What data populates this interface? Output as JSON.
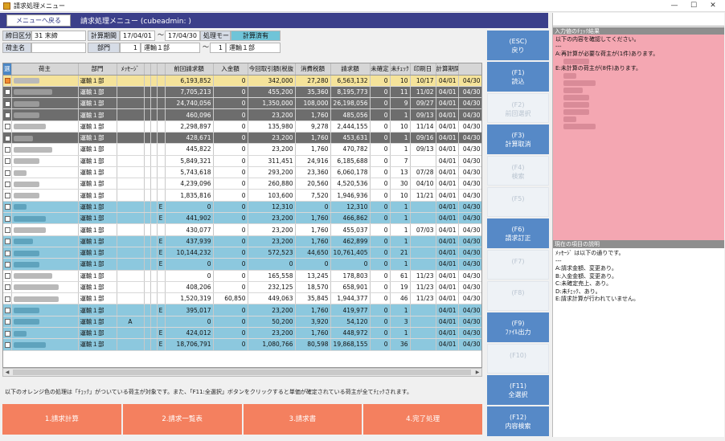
{
  "window": {
    "title": "請求処理メニュー",
    "min": "—",
    "max": "☐",
    "close": "✕"
  },
  "header": {
    "back_label": "メニューへ戻る",
    "title": "請求処理メニュー (cubeadmin:              )"
  },
  "filters": {
    "date_div_label": "締日区分",
    "date_div_code": "31",
    "date_div_value": "末締",
    "period_label": "計算期間",
    "period_from": "17/04/01",
    "period_sep": "～",
    "period_to": "17/04/30",
    "mode_label": "処理モード",
    "mode_value": "計算済有",
    "shipper_label": "荷主名",
    "dept_label": "部門",
    "dept_code": "1",
    "dept_value": "運輸１部",
    "dept_sep": "～",
    "dept_code2": "1",
    "dept_value2": "運輸１部"
  },
  "table": {
    "columns": [
      "選",
      "荷主",
      "部門",
      "ﾒｯｾｰｼﾞ",
      "",
      "",
      "",
      "前回請求額",
      "入金額",
      "今回取引額(税抜",
      "消費税額",
      "請求額",
      "未確定",
      "未ﾁｪｯｸ",
      "印刷日",
      "計算期間",
      ""
    ],
    "rows": [
      {
        "style": "yellow",
        "checked": true,
        "shipper": "青文物流",
        "dept": "運輸１部",
        "m1": "",
        "m4": "",
        "prev": "6,193,852",
        "paid": "0",
        "cur": "342,000",
        "tax": "27,280",
        "bill": "6,563,132",
        "unconf": "0",
        "unchk": "10",
        "print": "10/17",
        "from": "04/01",
        "to": "04/30"
      },
      {
        "style": "gray",
        "checked": false,
        "shipper": "運輸一丸海運",
        "dept": "運輸１部",
        "m1": "",
        "m4": "",
        "prev": "7,705,213",
        "paid": "0",
        "cur": "455,200",
        "tax": "35,360",
        "bill": "8,195,773",
        "unconf": "0",
        "unchk": "11",
        "print": "11/02",
        "from": "04/01",
        "to": "04/30"
      },
      {
        "style": "gray",
        "checked": false,
        "shipper": "伊藤商会",
        "dept": "運輸１部",
        "m1": "",
        "m4": "",
        "prev": "24,740,056",
        "paid": "0",
        "cur": "1,350,000",
        "tax": "108,000",
        "bill": "26,198,056",
        "unconf": "0",
        "unchk": "9",
        "print": "09/27",
        "from": "04/01",
        "to": "04/30"
      },
      {
        "style": "gray",
        "checked": false,
        "shipper": "大川物流",
        "dept": "運輸１部",
        "m1": "",
        "m4": "",
        "prev": "460,096",
        "paid": "0",
        "cur": "23,200",
        "tax": "1,760",
        "bill": "485,056",
        "unconf": "0",
        "unchk": "1",
        "print": "09/13",
        "from": "04/01",
        "to": "04/30"
      },
      {
        "style": "white",
        "checked": false,
        "shipper": "大森ノーズ",
        "dept": "運輸１部",
        "m1": "",
        "m4": "",
        "prev": "2,298,897",
        "paid": "0",
        "cur": "135,980",
        "tax": "9,278",
        "bill": "2,444,155",
        "unconf": "0",
        "unchk": "10",
        "print": "11/14",
        "from": "04/01",
        "to": "04/30"
      },
      {
        "style": "gray",
        "checked": false,
        "shipper": "山田商",
        "dept": "運輸１部",
        "m1": "",
        "m4": "",
        "prev": "428,671",
        "paid": "0",
        "cur": "23,200",
        "tax": "1,760",
        "bill": "453,631",
        "unconf": "0",
        "unchk": "1",
        "print": "09/16",
        "from": "04/01",
        "to": "04/30"
      },
      {
        "style": "white",
        "checked": false,
        "shipper": "九州運輸商会",
        "dept": "運輸１部",
        "m1": "",
        "m4": "",
        "prev": "445,822",
        "paid": "0",
        "cur": "23,200",
        "tax": "1,760",
        "bill": "470,782",
        "unconf": "0",
        "unchk": "1",
        "print": "09/13",
        "from": "04/01",
        "to": "04/30"
      },
      {
        "style": "white",
        "checked": false,
        "shipper": "木津運輸",
        "dept": "運輸１部",
        "m1": "",
        "m4": "",
        "prev": "5,849,321",
        "paid": "0",
        "cur": "311,451",
        "tax": "24,916",
        "bill": "6,185,688",
        "unconf": "0",
        "unchk": "7",
        "print": "",
        "from": "04/01",
        "to": "04/30"
      },
      {
        "style": "white",
        "checked": false,
        "shipper": "山手",
        "dept": "運輸１部",
        "m1": "",
        "m4": "",
        "prev": "5,743,618",
        "paid": "0",
        "cur": "293,200",
        "tax": "23,360",
        "bill": "6,060,178",
        "unconf": "0",
        "unchk": "13",
        "print": "07/28",
        "from": "04/01",
        "to": "04/30"
      },
      {
        "style": "white",
        "checked": false,
        "shipper": "北運倉庫",
        "dept": "運輸１部",
        "m1": "",
        "m4": "",
        "prev": "4,239,096",
        "paid": "0",
        "cur": "260,880",
        "tax": "20,560",
        "bill": "4,520,536",
        "unconf": "0",
        "unchk": "30",
        "print": "04/10",
        "from": "04/01",
        "to": "04/30"
      },
      {
        "style": "white",
        "checked": false,
        "shipper": "岡田運輸",
        "dept": "運輸１部",
        "m1": "",
        "m4": "",
        "prev": "1,835,816",
        "paid": "0",
        "cur": "103,600",
        "tax": "7,520",
        "bill": "1,946,936",
        "unconf": "0",
        "unchk": "10",
        "print": "11/21",
        "from": "04/01",
        "to": "04/30"
      },
      {
        "style": "blue",
        "checked": false,
        "shipper": "鐘山",
        "dept": "運輸１部",
        "m1": "",
        "m4": "E",
        "prev": "0",
        "paid": "0",
        "cur": "12,310",
        "tax": "0",
        "bill": "12,310",
        "unconf": "0",
        "unchk": "1",
        "print": "",
        "from": "04/01",
        "to": "04/30"
      },
      {
        "style": "blue",
        "checked": false,
        "shipper": "日本ワイン",
        "dept": "運輸１部",
        "m1": "",
        "m4": "E",
        "prev": "441,902",
        "paid": "0",
        "cur": "23,200",
        "tax": "1,760",
        "bill": "466,862",
        "unconf": "0",
        "unchk": "1",
        "print": "",
        "from": "04/01",
        "to": "04/30"
      },
      {
        "style": "white",
        "checked": false,
        "shipper": "はじや食事",
        "dept": "運輸１部",
        "m1": "",
        "m4": "",
        "prev": "430,077",
        "paid": "0",
        "cur": "23,200",
        "tax": "1,760",
        "bill": "455,037",
        "unconf": "0",
        "unchk": "1",
        "print": "07/03",
        "from": "04/01",
        "to": "04/30"
      },
      {
        "style": "blue",
        "checked": false,
        "shipper": "ま大鉄",
        "dept": "運輸１部",
        "m1": "",
        "m4": "E",
        "prev": "437,939",
        "paid": "0",
        "cur": "23,200",
        "tax": "1,760",
        "bill": "462,899",
        "unconf": "0",
        "unchk": "1",
        "print": "",
        "from": "04/01",
        "to": "04/30"
      },
      {
        "style": "blue",
        "checked": false,
        "shipper": "深沢食品",
        "dept": "運輸１部",
        "m1": "",
        "m4": "E",
        "prev": "10,144,232",
        "paid": "0",
        "cur": "572,523",
        "tax": "44,650",
        "bill": "10,761,405",
        "unconf": "0",
        "unchk": "21",
        "print": "",
        "from": "04/01",
        "to": "04/30"
      },
      {
        "style": "blue",
        "checked": false,
        "shipper": "平成倉庫",
        "dept": "運輸１部",
        "m1": "",
        "m4": "E",
        "prev": "0",
        "paid": "0",
        "cur": "0",
        "tax": "0",
        "bill": "0",
        "unconf": "0",
        "unchk": "1",
        "print": "",
        "from": "04/01",
        "to": "04/30"
      },
      {
        "style": "white",
        "checked": false,
        "shipper": "ベストル運輸",
        "dept": "運輸１部",
        "m1": "",
        "m4": "",
        "prev": "0",
        "paid": "0",
        "cur": "165,558",
        "tax": "13,245",
        "bill": "178,803",
        "unconf": "0",
        "unchk": "61",
        "print": "11/23",
        "from": "04/01",
        "to": "04/30"
      },
      {
        "style": "white",
        "checked": false,
        "shipper": "ベストル運輸二",
        "dept": "運輸１部",
        "m1": "",
        "m4": "",
        "prev": "408,206",
        "paid": "0",
        "cur": "232,125",
        "tax": "18,570",
        "bill": "658,901",
        "unconf": "0",
        "unchk": "19",
        "print": "11/23",
        "from": "04/01",
        "to": "04/30"
      },
      {
        "style": "white",
        "checked": false,
        "shipper": "ベストル運輸三",
        "dept": "運輸１部",
        "m1": "",
        "m4": "",
        "prev": "1,520,319",
        "paid": "60,850",
        "cur": "449,063",
        "tax": "35,845",
        "bill": "1,944,377",
        "unconf": "0",
        "unchk": "46",
        "print": "11/23",
        "from": "04/01",
        "to": "04/30"
      },
      {
        "style": "blue",
        "checked": false,
        "shipper": "町田運輸",
        "dept": "運輸１部",
        "m1": "",
        "m4": "E",
        "prev": "395,017",
        "paid": "0",
        "cur": "23,200",
        "tax": "1,760",
        "bill": "419,977",
        "unconf": "0",
        "unchk": "1",
        "print": "",
        "from": "04/01",
        "to": "04/30"
      },
      {
        "style": "blue",
        "checked": false,
        "shipper": "山口商店",
        "dept": "運輸１部",
        "m1": "A",
        "m4": "",
        "prev": "0",
        "paid": "0",
        "cur": "50,200",
        "tax": "3,920",
        "bill": "54,120",
        "unconf": "0",
        "unchk": "3",
        "print": "",
        "from": "04/01",
        "to": "04/30"
      },
      {
        "style": "blue",
        "checked": false,
        "shipper": "湯道",
        "dept": "運輸１部",
        "m1": "",
        "m4": "E",
        "prev": "424,012",
        "paid": "0",
        "cur": "23,200",
        "tax": "1,760",
        "bill": "448,972",
        "unconf": "0",
        "unchk": "1",
        "print": "",
        "from": "04/01",
        "to": "04/30"
      },
      {
        "style": "blue",
        "checked": false,
        "shipper": "鐘下重食品",
        "dept": "運輸１部",
        "m1": "",
        "m4": "E",
        "prev": "18,706,791",
        "paid": "0",
        "cur": "1,080,766",
        "tax": "80,598",
        "bill": "19,868,155",
        "unconf": "0",
        "unchk": "36",
        "print": "",
        "from": "04/01",
        "to": "04/30"
      }
    ]
  },
  "note": "以下のオレンジ色の処理は「ﾁｪｯｸ」がついている荷主が対象です。また、「F11:全選択」ボタンをクリックすると単価が確定されている荷主が全てﾁｪｯｸされます。",
  "bottom_buttons": [
    "1.請求計算",
    "2.請求一覧表",
    "3.請求書",
    "4.完了処理"
  ],
  "fkeys": [
    {
      "key": "(ESC)",
      "label": "戻り",
      "enabled": true
    },
    {
      "key": "(F1)",
      "label": "読込",
      "enabled": true
    },
    {
      "key": "(F2)",
      "label": "前回選択",
      "enabled": false
    },
    {
      "key": "(F3)",
      "label": "計算取消",
      "enabled": true
    },
    {
      "key": "(F4)",
      "label": "検索",
      "enabled": false
    },
    {
      "key": "(F5)",
      "label": "",
      "enabled": false
    },
    {
      "key": "(F6)",
      "label": "請求訂正",
      "enabled": true
    },
    {
      "key": "(F7)",
      "label": "",
      "enabled": false
    },
    {
      "key": "(F8)",
      "label": "",
      "enabled": false
    },
    {
      "key": "(F9)",
      "label": "ﾌｧｲﾙ出力",
      "enabled": true
    },
    {
      "key": "(F10)",
      "label": "",
      "enabled": false
    },
    {
      "key": "(F11)",
      "label": "全選択",
      "enabled": true
    },
    {
      "key": "(F12)",
      "label": "内容検索",
      "enabled": true
    }
  ],
  "right": {
    "check_title": "入力値のﾁｪｯｸ結果",
    "check_lines": [
      "以下の内容を確認してください。",
      "---",
      "A:再計算が必要な荷主が(1件)あります。",
      "E:未計算の荷主が(8件)あります。"
    ],
    "check_a_items": [
      "山口商店"
    ],
    "check_e_items": [
      "鐘山",
      "日本ワイン",
      "ま大鉄",
      "深沢食品",
      "平成倉庫",
      "町田運輸",
      "湯道",
      "鐘下重食品"
    ],
    "desc_title": "現在の項目の説明",
    "desc_lines": [
      "ﾒｯｾｰｼﾞ は以下の通りです。",
      "---",
      "A:請求金額、変更あり。",
      "B:入金金額、変更あり。",
      "C:未確定売上、あり。",
      "D:未ﾁｪｯｸ、あり。",
      "E:請求計算が行われていません。"
    ]
  }
}
